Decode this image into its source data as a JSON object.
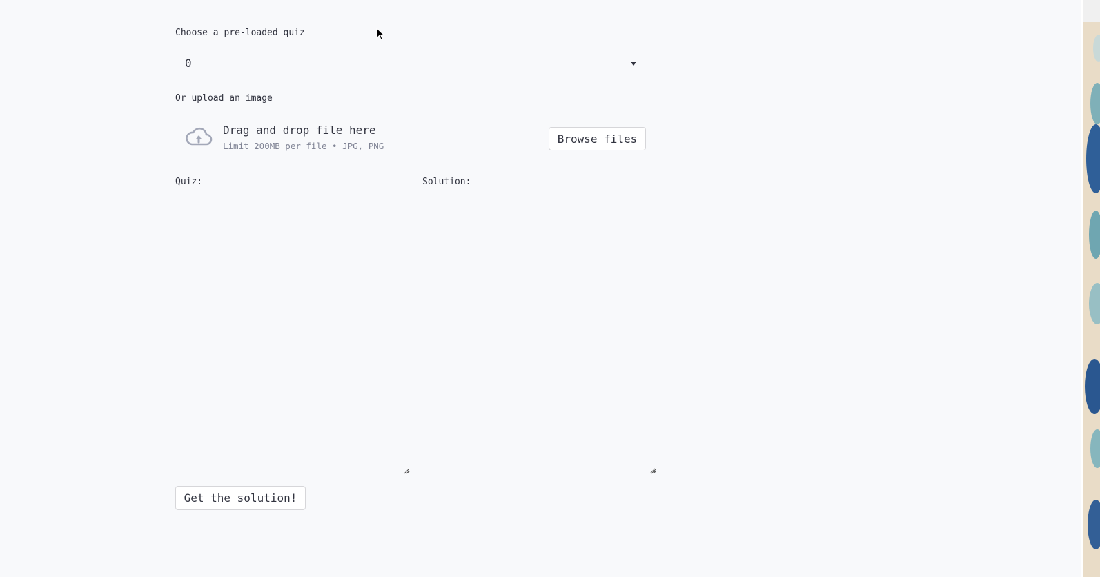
{
  "quiz_select": {
    "label": "Choose a pre-loaded quiz",
    "value": "0"
  },
  "upload": {
    "label": "Or upload an image",
    "drop_title": "Drag and drop file here",
    "drop_subtitle": "Limit 200MB per file • JPG, PNG",
    "browse_label": "Browse files",
    "icon": "cloud-upload-icon"
  },
  "quiz_field": {
    "label": "Quiz:",
    "value": ""
  },
  "solution_field": {
    "label": "Solution:",
    "value": ""
  },
  "action": {
    "label": "Get the solution!"
  },
  "colors": {
    "background": "#f8f9fb",
    "text": "#31333f",
    "muted": "#808495",
    "icon": "#a3a8b8"
  }
}
